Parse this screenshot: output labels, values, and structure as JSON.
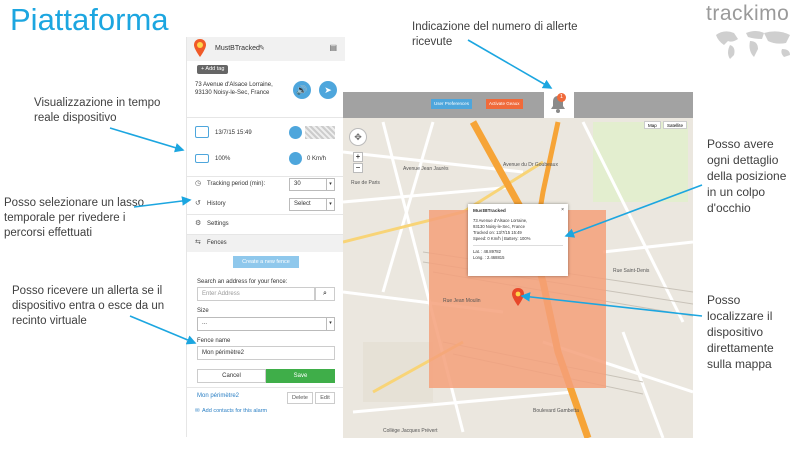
{
  "slide": {
    "title": "Piattaforma",
    "brand": "trackimo"
  },
  "callouts": {
    "alerts_count": "Indicazione del numero di allerte ricevute",
    "realtime": "Visualizzazione in tempo reale dispositivo",
    "timespan": "Posso selezionare un lasso temporale per rivedere i percorsi effettuati",
    "fence_alert": "Posso ricevere un allerta se il dispositivo entra o esce da un recinto virtuale",
    "details": "Posso avere ogni dettaglio della posizione in un colpo d'occhio",
    "locate": "Posso localizzare il dispositivo direttamente sulla mappa"
  },
  "device": {
    "name": "MustBTracked",
    "add_tag": "+ Add tag",
    "address": "73 Avenue d'Alsace Lorraine, 93130 Noisy-le-Sec, France",
    "datetime": "13/7/15 15:49",
    "battery": "100%",
    "speed": "0 Km/h"
  },
  "tracking": {
    "label": "Tracking period (min):",
    "value": "30"
  },
  "history": {
    "label": "History",
    "value": "Select"
  },
  "settings": {
    "label": "Settings"
  },
  "fences": {
    "label": "Fences",
    "create_btn": "Create a new fence",
    "search_label": "Search an address for your fence:",
    "search_placeholder": "Enter Address",
    "size_label": "Size",
    "size_value": "...",
    "name_label": "Fence name",
    "name_value": "Mon périmètre2",
    "cancel": "Cancel",
    "save": "Save",
    "existing_name": "Mon périmètre2",
    "delete": "Delete",
    "edit": "Edit",
    "add_contacts": "Add contacts for this alarm"
  },
  "map": {
    "btn_prefs": "User Preferences",
    "btn_alerts": "Activate Geaux",
    "alert_count": "1",
    "map_tab": "Map",
    "sat_tab": "Satellite",
    "street_labels": [
      "Rue de Paris",
      "Avenue Jean Jaurès",
      "Avenue du Dr Goubeaux",
      "Rue Jean Moulin",
      "Rue Saint-Denis",
      "Boulevard Gambetta",
      "Collège Jacques Prévert"
    ]
  },
  "popup": {
    "title": "MustBTracked",
    "line1": "73 Avenue d'Alsace Lorraine,",
    "line2": "93130 Noisy-le-Sec, France",
    "line3": "Tracked on: 13/7/15 15:49",
    "line4": "Speed: 0 Km/h | Battery: 100%",
    "lat": "Lat. : 48.89782",
    "lng": "Long. : 2.468815"
  },
  "colors": {
    "accent": "#1ca6e0",
    "save": "#3fae49",
    "fence": "#f5a07a",
    "route": "#f6a437"
  }
}
